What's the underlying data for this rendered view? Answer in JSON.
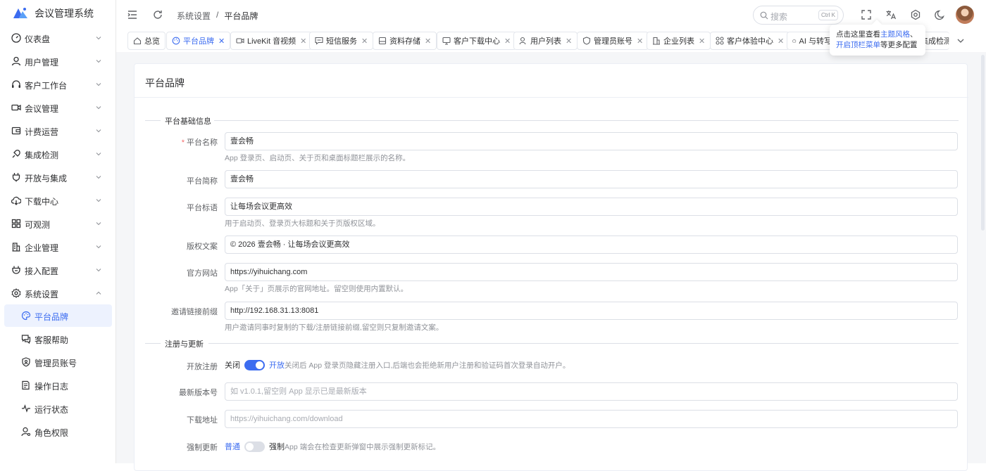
{
  "app": {
    "title": "会议管理系统"
  },
  "sidebar": {
    "items": [
      {
        "label": "仪表盘",
        "icon": "dashboard-icon"
      },
      {
        "label": "用户管理",
        "icon": "user-icon"
      },
      {
        "label": "客户工作台",
        "icon": "headset-icon"
      },
      {
        "label": "会议管理",
        "icon": "video-icon"
      },
      {
        "label": "计费运营",
        "icon": "wallet-icon"
      },
      {
        "label": "集成检测",
        "icon": "plug-check-icon"
      },
      {
        "label": "开放与集成",
        "icon": "plug-icon"
      },
      {
        "label": "下载中心",
        "icon": "cloud-download-icon"
      },
      {
        "label": "可观测",
        "icon": "grid-icon"
      },
      {
        "label": "企业管理",
        "icon": "building-icon"
      },
      {
        "label": "接入配置",
        "icon": "connect-icon"
      },
      {
        "label": "系统设置",
        "icon": "gear-icon"
      }
    ],
    "sub_items": [
      {
        "label": "平台品牌",
        "icon": "palette-icon",
        "active": true
      },
      {
        "label": "客服帮助",
        "icon": "chat-icon"
      },
      {
        "label": "管理员账号",
        "icon": "shield-icon"
      },
      {
        "label": "操作日志",
        "icon": "doc-icon"
      },
      {
        "label": "运行状态",
        "icon": "pulse-icon"
      },
      {
        "label": "角色权限",
        "icon": "role-icon"
      }
    ]
  },
  "header": {
    "breadcrumb": [
      "系统设置",
      "平台品牌"
    ],
    "breadcrumb_sep": "/",
    "search_placeholder": "搜索",
    "search_shortcut": "Ctrl K"
  },
  "tabs": [
    {
      "label": "总览",
      "icon": "home-icon",
      "closable": false
    },
    {
      "label": "平台品牌",
      "icon": "palette-icon",
      "active": true
    },
    {
      "label": "LiveKit 音视频",
      "icon": "video-icon"
    },
    {
      "label": "短信服务",
      "icon": "message-icon"
    },
    {
      "label": "资料存储",
      "icon": "storage-icon"
    },
    {
      "label": "客户下载中心",
      "icon": "monitor-icon"
    },
    {
      "label": "用户列表",
      "icon": "users-icon"
    },
    {
      "label": "管理员账号",
      "icon": "shield-icon"
    },
    {
      "label": "企业列表",
      "icon": "building-icon"
    },
    {
      "label": "客户体验中心",
      "icon": "apps-icon"
    },
    {
      "label": "AI 与转写",
      "icon": "robot-icon"
    },
    {
      "label": "集成检测",
      "icon": "pulse-icon"
    }
  ],
  "tooltip": {
    "line1": "点击这里查看",
    "link1": "主题风格",
    "sep": "、",
    "link2": "开启顶栏菜单",
    "line2": "等更多配置"
  },
  "page": {
    "title": "平台品牌",
    "section_basic": "平台基础信息",
    "section_register": "注册与更新",
    "fields": {
      "name": {
        "label": "平台名称",
        "value": "壹会畅",
        "hint": "App 登录页、启动页、关于页和桌面标题栏展示的名称。"
      },
      "short": {
        "label": "平台简称",
        "value": "壹会畅"
      },
      "slogan": {
        "label": "平台标语",
        "value": "让每场会议更高效",
        "hint": "用于启动页、登录页大标题和关于页版权区域。"
      },
      "copyright": {
        "label": "版权文案",
        "value": "© 2026 壹会畅 · 让每场会议更高效"
      },
      "website": {
        "label": "官方网站",
        "value": "https://yihuichang.com",
        "hint": "App「关于」页展示的官网地址。留空则使用内置默认。"
      },
      "invite": {
        "label": "邀请链接前缀",
        "value": "http://192.168.31.13:8081",
        "hint": "用户邀请同事时复制的下载/注册链接前缀,留空则只复制邀请文案。"
      },
      "open_register": {
        "label": "开放注册",
        "off_label": "关闭",
        "on_label": "开放",
        "desc": "关闭后 App 登录页隐藏注册入口,后端也会拒绝新用户注册和验证码首次登录自动开户。"
      },
      "version": {
        "label": "最新版本号",
        "placeholder": "如 v1.0.1,留空则 App 显示已是最新版本"
      },
      "download": {
        "label": "下载地址",
        "placeholder": "https://yihuichang.com/download"
      },
      "force": {
        "label": "强制更新",
        "off_label": "普通",
        "on_label": "强制",
        "desc": "App 端会在检查更新弹窗中展示强制更新标记。"
      }
    }
  },
  "colors": {
    "accent": "#3c6cf0",
    "required": "#f56c6c"
  }
}
